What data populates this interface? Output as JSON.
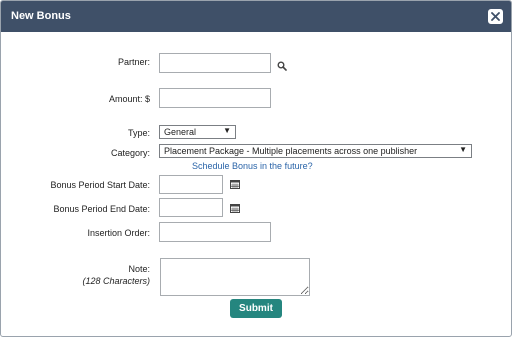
{
  "dialog": {
    "title": "New Bonus",
    "close_icon": "close-icon"
  },
  "form": {
    "partner": {
      "label": "Partner:",
      "value": "",
      "icon": "search-icon"
    },
    "amount": {
      "label": "Amount: $",
      "value": ""
    },
    "type": {
      "label": "Type:",
      "selected": "General"
    },
    "category": {
      "label": "Category:",
      "selected": "Placement Package - Multiple placements across one publisher"
    },
    "schedule_link": "Schedule Bonus in the future?",
    "start_date": {
      "label": "Bonus Period Start Date:",
      "value": "",
      "icon": "calendar-icon"
    },
    "end_date": {
      "label": "Bonus Period End Date:",
      "value": "",
      "icon": "calendar-icon"
    },
    "insertion_order": {
      "label": "Insertion Order:",
      "value": ""
    },
    "note": {
      "label": "Note:",
      "sublabel": "(128 Characters)",
      "value": ""
    },
    "submit_label": "Submit"
  }
}
